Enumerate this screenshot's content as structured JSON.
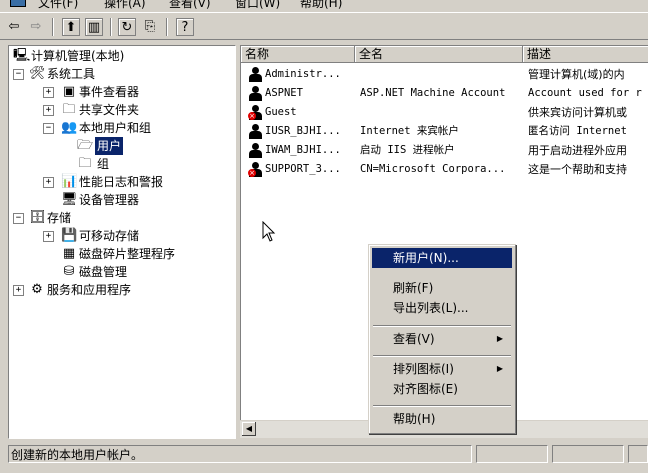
{
  "menubar": {
    "items": [
      "文件(F)",
      "操作(A)",
      "查看(V)",
      "窗口(W)",
      "帮助(H)"
    ]
  },
  "toolbar": {
    "buttons": [
      "back-icon",
      "forward-icon",
      "up-folder-icon",
      "show-hide-tree-icon",
      "refresh-icon",
      "export-list-icon",
      "help-icon"
    ]
  },
  "tree": {
    "root": "计算机管理(本地)",
    "system_tools": "系统工具",
    "event_viewer": "事件查看器",
    "shared_folders": "共享文件夹",
    "local_users_groups": "本地用户和组",
    "users": "用户",
    "groups": "组",
    "perf_logs": "性能日志和警报",
    "device_manager": "设备管理器",
    "storage": "存储",
    "removable_storage": "可移动存储",
    "defrag": "磁盘碎片整理程序",
    "disk_mgmt": "磁盘管理",
    "services_apps": "服务和应用程序"
  },
  "list": {
    "headers": [
      "名称",
      "全名",
      "描述"
    ],
    "rows": [
      {
        "name": "Administr...",
        "fullname": "",
        "desc": "管理计算机(域)的内",
        "disabled": false
      },
      {
        "name": "ASPNET",
        "fullname": "ASP.NET Machine Account",
        "desc": "Account used for r",
        "disabled": false
      },
      {
        "name": "Guest",
        "fullname": "",
        "desc": "供来宾访问计算机或",
        "disabled": true
      },
      {
        "name": "IUSR_BJHI...",
        "fullname": "Internet 来宾帐户",
        "desc": "匿名访问 Internet",
        "disabled": false
      },
      {
        "name": "IWAM_BJHI...",
        "fullname": "启动 IIS 进程帐户",
        "desc": "用于启动进程外应用",
        "disabled": false
      },
      {
        "name": "SUPPORT_3...",
        "fullname": "CN=Microsoft Corpora...",
        "desc": "这是一个帮助和支持",
        "disabled": true
      }
    ]
  },
  "context_menu": {
    "new_user": "新用户(N)...",
    "refresh": "刷新(F)",
    "export_list": "导出列表(L)...",
    "view": "查看(V)",
    "arrange_icons": "排列图标(I)",
    "line_up_icons": "对齐图标(E)",
    "help": "帮助(H)"
  },
  "status": {
    "text": "创建新的本地用户帐户。"
  }
}
